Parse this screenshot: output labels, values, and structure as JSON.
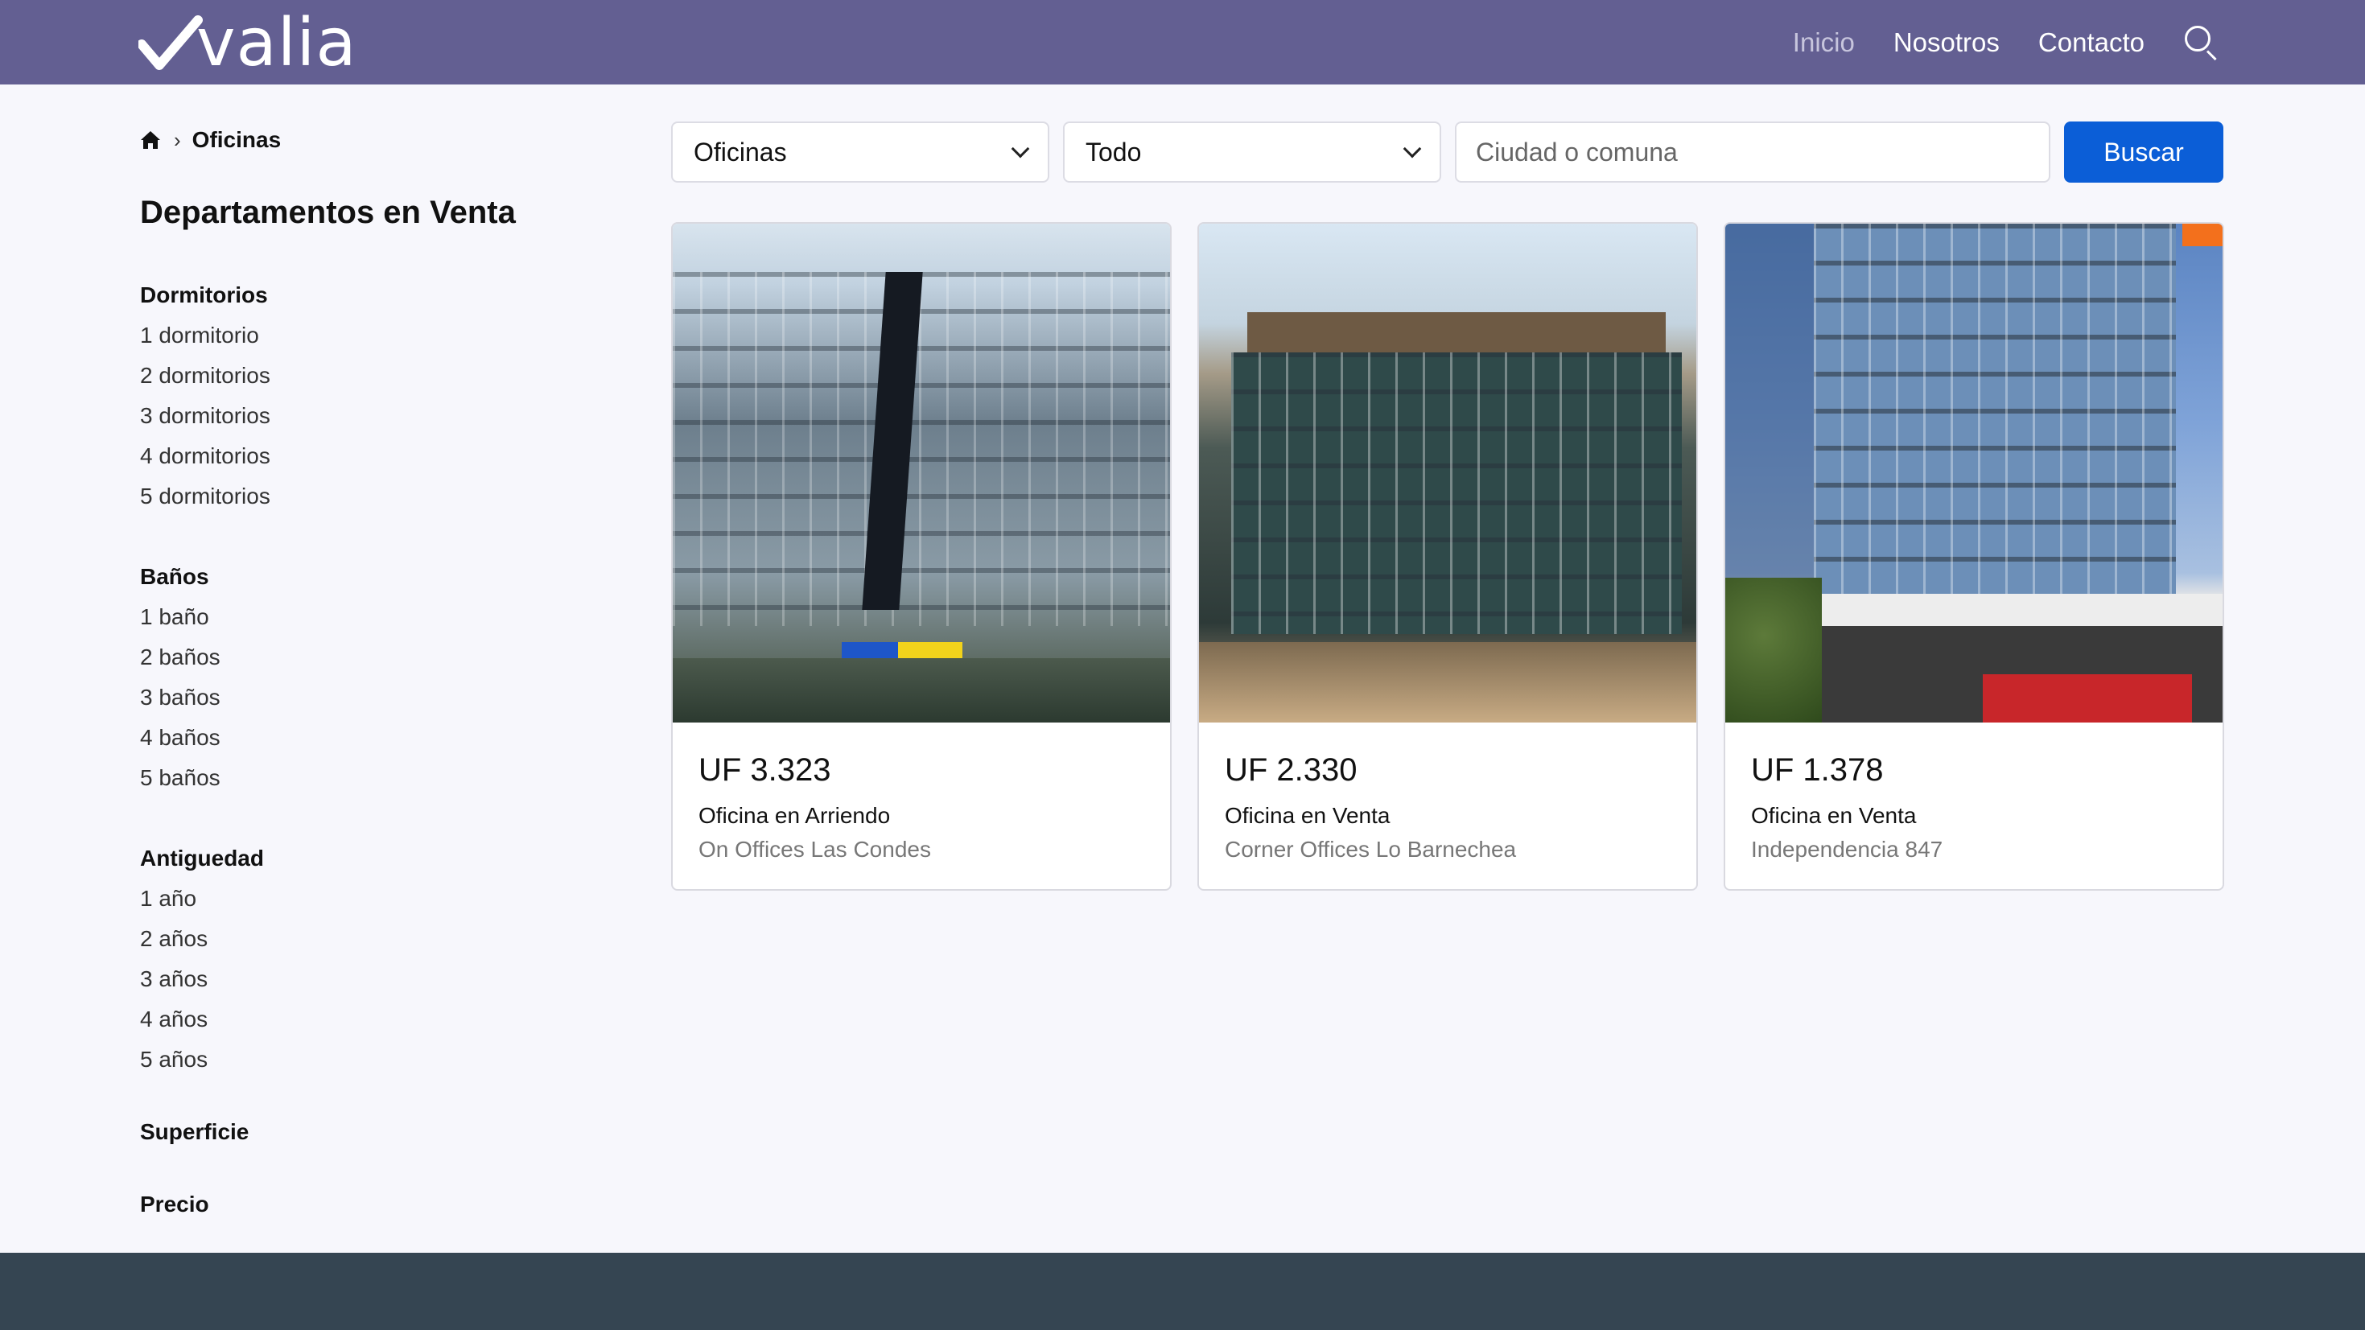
{
  "brand": {
    "logo_text": "valia"
  },
  "nav": {
    "items": [
      "Inicio",
      "Nosotros",
      "Contacto"
    ],
    "active": "Inicio"
  },
  "breadcrumb": {
    "current": "Oficinas"
  },
  "sidebar": {
    "title": "Departamentos en Venta",
    "facets": [
      {
        "title": "Dormitorios",
        "items": [
          "1 dormitorio",
          "2 dormitorios",
          "3 dormitorios",
          "4 dormitorios",
          "5 dormitorios"
        ]
      },
      {
        "title": "Baños",
        "items": [
          "1 baño",
          "2 baños",
          "3 baños",
          "4 baños",
          "5 baños"
        ]
      },
      {
        "title": "Antiguedad",
        "items": [
          "1 año",
          "2 años",
          "3 años",
          "4 años",
          "5 años"
        ]
      },
      {
        "title": "Superficie",
        "items": []
      },
      {
        "title": "Precio",
        "items": []
      }
    ]
  },
  "search": {
    "type_value": "Oficinas",
    "operation_value": "Todo",
    "city_placeholder": "Ciudad o comuna",
    "button_label": "Buscar"
  },
  "listings": [
    {
      "price": "UF 3.323",
      "type": "Oficina en Arriendo",
      "name": "On Offices Las Condes"
    },
    {
      "price": "UF 2.330",
      "type": "Oficina en Venta",
      "name": "Corner Offices Lo Barnechea"
    },
    {
      "price": "UF 1.378",
      "type": "Oficina en Venta",
      "name": "Independencia 847"
    }
  ],
  "colors": {
    "header": "#635f92",
    "primary_button": "#0b5ed7",
    "footer": "#354552"
  }
}
